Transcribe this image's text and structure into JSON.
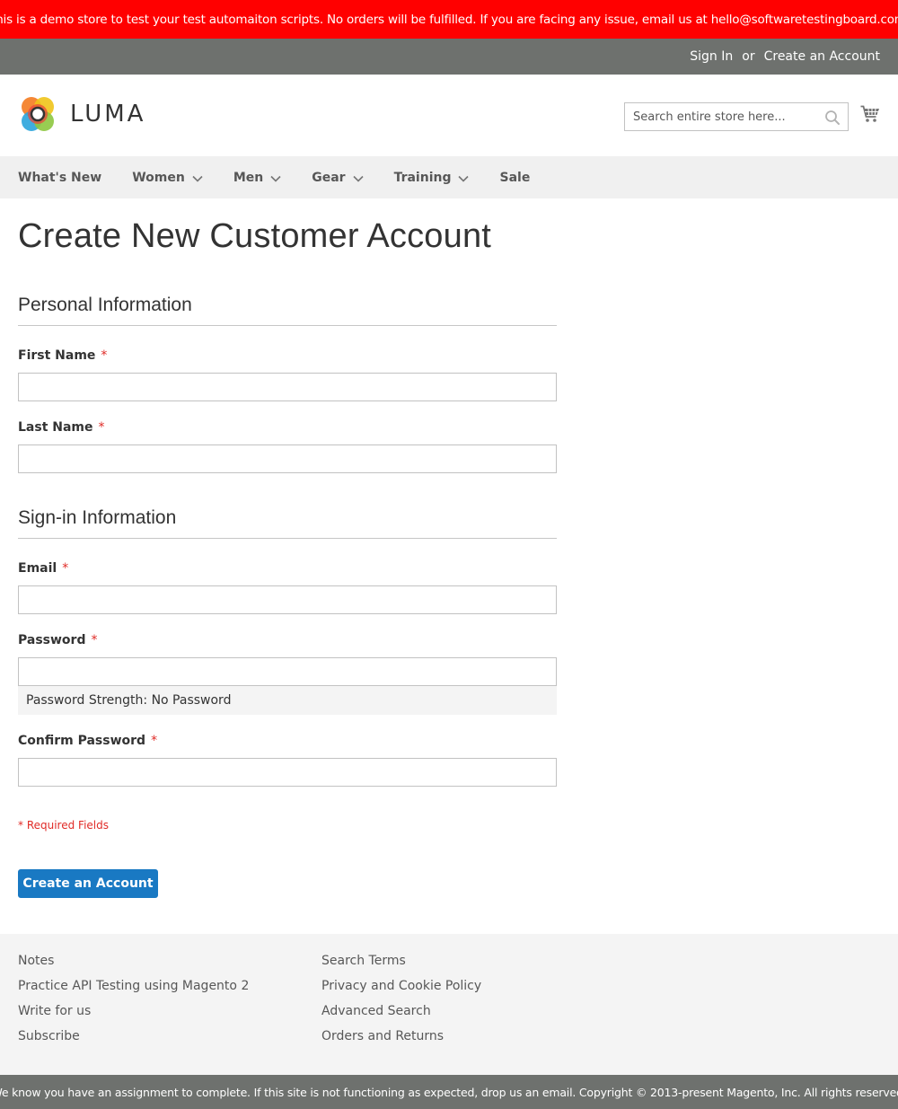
{
  "banner": {
    "text": "This is a demo store to test your test automaiton scripts. No orders will be fulfilled. If you are facing any issue, email us at hello@softwaretestingboard.com."
  },
  "top_links": {
    "sign_in": "Sign In",
    "or": "or",
    "create_account": "Create an Account"
  },
  "header": {
    "logo_text": "LUMA",
    "search_placeholder": "Search entire store here...",
    "search_icon": "magnifier-icon",
    "cart_icon": "cart-icon"
  },
  "nav": {
    "items": [
      {
        "label": "What's New"
      },
      {
        "label": "Women"
      },
      {
        "label": "Men"
      },
      {
        "label": "Gear"
      },
      {
        "label": "Training"
      },
      {
        "label": "Sale"
      }
    ]
  },
  "page": {
    "title": "Create New Customer Account"
  },
  "personal": {
    "legend": "Personal Information",
    "first_name_label": "First Name",
    "first_name_value": "",
    "last_name_label": "Last Name",
    "last_name_value": ""
  },
  "signin": {
    "legend": "Sign-in Information",
    "email_label": "Email",
    "email_value": "",
    "password_label": "Password",
    "password_value": "",
    "password_strength": "Password Strength: No Password",
    "confirm_label": "Confirm Password",
    "confirm_value": ""
  },
  "form": {
    "required_asterisk": "*",
    "required_note": "* Required Fields",
    "submit_label": "Create an Account"
  },
  "footer": {
    "col1": [
      "Notes",
      "Practice API Testing using Magento 2",
      "Write for us",
      "Subscribe"
    ],
    "col2": [
      "Search Terms",
      "Privacy and Cookie Policy",
      "Advanced Search",
      "Orders and Returns"
    ]
  },
  "copyright": {
    "text": "We know you have an assignment to complete. If this site is not functioning as expected, drop us an email. Copyright © 2013-present Magento, Inc. All rights reserved."
  },
  "colors": {
    "banner_bg": "#ff0000",
    "top_bar_bg": "#6e716e",
    "nav_bg": "#f0f0f0",
    "button_bg": "#1979c3",
    "required": "#e02b27"
  }
}
